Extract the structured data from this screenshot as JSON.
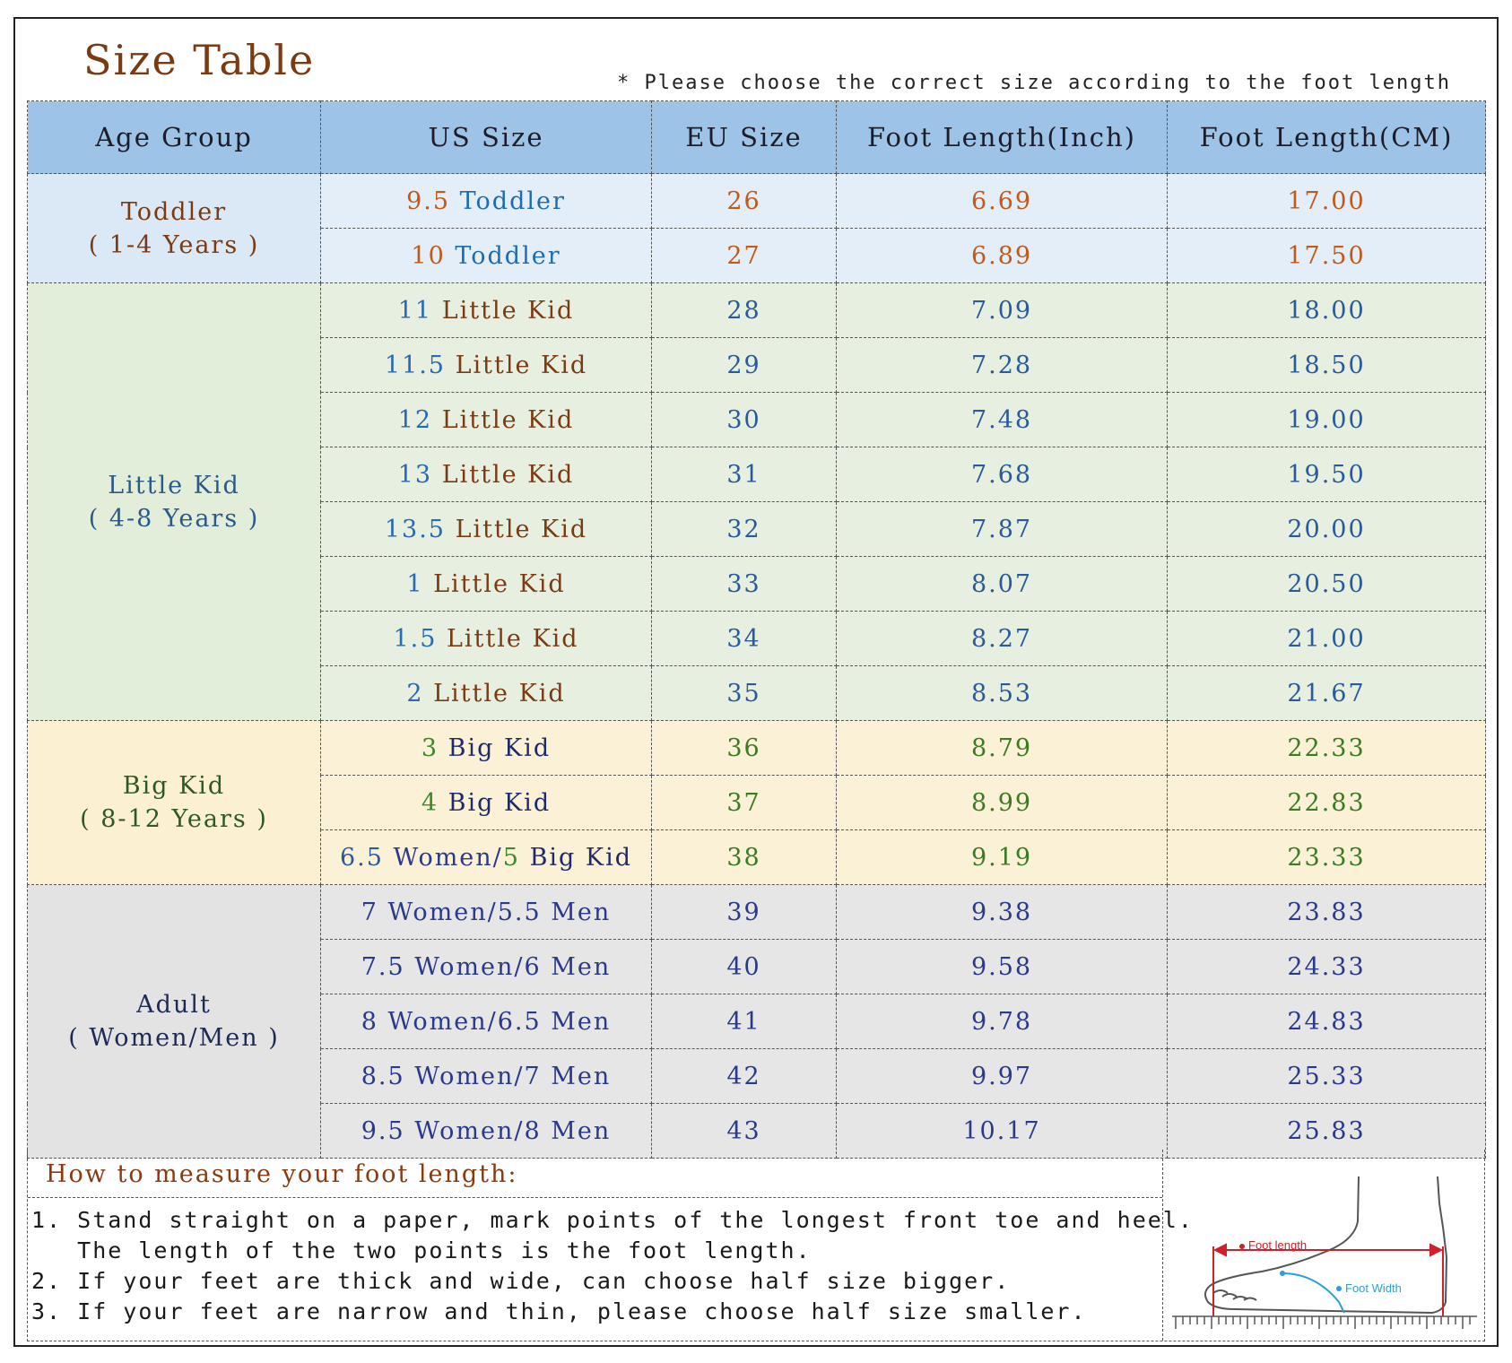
{
  "title": "Size Table",
  "note": "* Please choose the correct size according to the foot length",
  "headers": [
    "Age Group",
    "US Size",
    "EU Size",
    "Foot Length(Inch)",
    "Foot Length(CM)"
  ],
  "groups": {
    "toddler": {
      "name": "Toddler",
      "range": "( 1-4 Years )"
    },
    "little_kid": {
      "name": "Little Kid",
      "range": "( 4-8 Years )"
    },
    "big_kid": {
      "name": "Big Kid",
      "range": "( 8-12 Years )"
    },
    "adult": {
      "name": "Adult",
      "range": "( Women/Men )"
    }
  },
  "rows": [
    {
      "us_num": "9.5",
      "us_label": "Toddler",
      "eu": "26",
      "inch": "6.69",
      "cm": "17.00"
    },
    {
      "us_num": "10",
      "us_label": "Toddler",
      "eu": "27",
      "inch": "6.89",
      "cm": "17.50"
    },
    {
      "us_num": "11",
      "us_label": "Little Kid",
      "eu": "28",
      "inch": "7.09",
      "cm": "18.00"
    },
    {
      "us_num": "11.5",
      "us_label": "Little Kid",
      "eu": "29",
      "inch": "7.28",
      "cm": "18.50"
    },
    {
      "us_num": "12",
      "us_label": "Little Kid",
      "eu": "30",
      "inch": "7.48",
      "cm": "19.00"
    },
    {
      "us_num": "13",
      "us_label": "Little Kid",
      "eu": "31",
      "inch": "7.68",
      "cm": "19.50"
    },
    {
      "us_num": "13.5",
      "us_label": "Little Kid",
      "eu": "32",
      "inch": "7.87",
      "cm": "20.00"
    },
    {
      "us_num": "1",
      "us_label": "Little Kid",
      "eu": "33",
      "inch": "8.07",
      "cm": "20.50"
    },
    {
      "us_num": "1.5",
      "us_label": "Little Kid",
      "eu": "34",
      "inch": "8.27",
      "cm": "21.00"
    },
    {
      "us_num": "2",
      "us_label": "Little Kid",
      "eu": "35",
      "inch": "8.53",
      "cm": "21.67"
    },
    {
      "us_num": "3",
      "us_label": "Big Kid",
      "eu": "36",
      "inch": "8.79",
      "cm": "22.33"
    },
    {
      "us_num": "4",
      "us_label": "Big Kid",
      "eu": "37",
      "inch": "8.99",
      "cm": "22.83"
    },
    {
      "us_num": "6.5",
      "us_label": "Women/",
      "us_num2": "5",
      "us_label2": "Big Kid",
      "eu": "38",
      "inch": "9.19",
      "cm": "23.33"
    },
    {
      "us_text": "7 Women/5.5 Men",
      "eu": "39",
      "inch": "9.38",
      "cm": "23.83"
    },
    {
      "us_text": "7.5 Women/6 Men",
      "eu": "40",
      "inch": "9.58",
      "cm": "24.33"
    },
    {
      "us_text": "8 Women/6.5 Men",
      "eu": "41",
      "inch": "9.78",
      "cm": "24.83"
    },
    {
      "us_text": "8.5 Women/7 Men",
      "eu": "42",
      "inch": "9.97",
      "cm": "25.33"
    },
    {
      "us_text": "9.5 Women/8 Men",
      "eu": "43",
      "inch": "10.17",
      "cm": "25.83"
    }
  ],
  "measure": {
    "heading": "How to measure your foot length:",
    "lines": [
      "1. Stand straight on a paper, mark points of the longest front toe and heel.",
      "   The length of the two points is the foot length.",
      "2. If your feet are thick and wide, can choose half size bigger.",
      "3. If your feet are narrow and thin, please choose half size smaller."
    ],
    "diagram_labels": {
      "length": "Foot length",
      "width": "Foot Width"
    }
  },
  "colors": {
    "header_bg": "#9dc3e6",
    "toddler_bg": "#e4eef8",
    "little_kid_bg": "#e7f0e0",
    "big_kid_bg": "#fbf1d6",
    "adult_bg": "#e6e6e6",
    "diagram_red": "#d0202a",
    "diagram_blue": "#2aa0d8"
  }
}
